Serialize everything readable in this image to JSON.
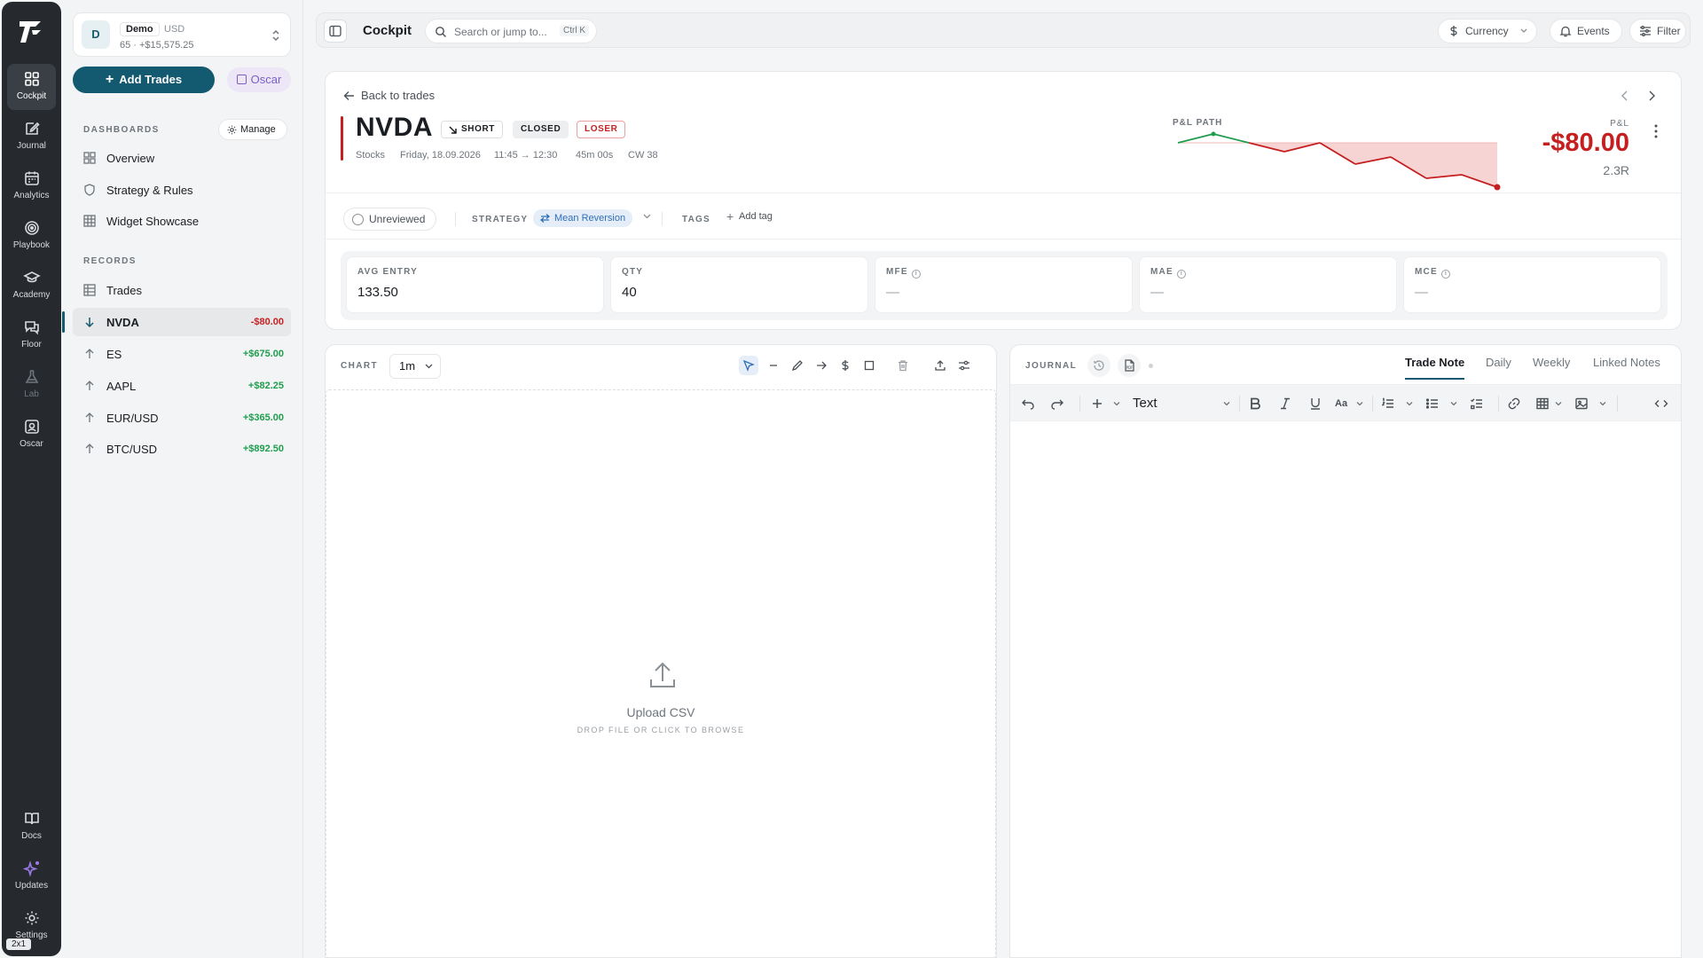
{
  "rail": {
    "items": [
      {
        "label": "Cockpit",
        "icon": "grid-icon"
      },
      {
        "label": "Journal",
        "icon": "journal-icon"
      },
      {
        "label": "Analytics",
        "icon": "calendar-icon"
      },
      {
        "label": "Playbook",
        "icon": "target-icon"
      },
      {
        "label": "Academy",
        "icon": "graduation-cap-icon"
      },
      {
        "label": "Floor",
        "icon": "chat-icon"
      },
      {
        "label": "Lab",
        "icon": "flask-icon"
      },
      {
        "label": "Oscar",
        "icon": "oscar-icon"
      }
    ],
    "bottom": [
      {
        "label": "Docs",
        "icon": "book-icon"
      },
      {
        "label": "Updates",
        "icon": "sparkle-icon"
      },
      {
        "label": "Settings",
        "icon": "gear-icon"
      }
    ],
    "badge": "2x1"
  },
  "account": {
    "initial": "D",
    "name": "Demo",
    "currency": "USD",
    "summary": "65 · +$15,575.25"
  },
  "actions": {
    "add_trades": "Add Trades",
    "oscar": "Oscar"
  },
  "dashboards": {
    "label": "DASHBOARDS",
    "manage": "Manage",
    "items": [
      "Overview",
      "Strategy & Rules",
      "Widget Showcase"
    ]
  },
  "records": {
    "label": "RECORDS",
    "trades_label": "Trades",
    "items": [
      {
        "symbol": "NVDA",
        "pnl": "-$80.00",
        "direction": "down"
      },
      {
        "symbol": "ES",
        "pnl": "+$675.00",
        "direction": "up"
      },
      {
        "symbol": "AAPL",
        "pnl": "+$82.25",
        "direction": "up"
      },
      {
        "symbol": "EUR/USD",
        "pnl": "+$365.00",
        "direction": "up"
      },
      {
        "symbol": "BTC/USD",
        "pnl": "+$892.50",
        "direction": "up"
      }
    ]
  },
  "topbar": {
    "title": "Cockpit",
    "search_placeholder": "Search or jump to...",
    "search_shortcut": "Ctrl K",
    "currency": "Currency",
    "events": "Events",
    "filter": "Filter"
  },
  "trade": {
    "back": "Back to trades",
    "symbol": "NVDA",
    "side": "SHORT",
    "status": "CLOSED",
    "result": "LOSER",
    "asset_class": "Stocks",
    "date": "Friday, 18.09.2026",
    "time": "11:45 → 12:30",
    "duration": "45m 00s",
    "week": "CW 38",
    "pl_path_label": "P&L PATH",
    "pl_label": "P&L",
    "pl_value": "-$80.00",
    "r_multiple": "2.3R",
    "pl_path": [
      0.0,
      0.05,
      0.0,
      -0.05,
      0.0,
      -0.12,
      -0.08,
      -0.2,
      -0.18,
      -0.25
    ],
    "review_status": "Unreviewed",
    "strategy_label": "STRATEGY",
    "strategy": "Mean Reversion",
    "tags_label": "TAGS",
    "add_tag": "Add tag",
    "stats": [
      {
        "label": "AVG ENTRY",
        "value": "133.50",
        "info": false
      },
      {
        "label": "QTY",
        "value": "40",
        "info": false
      },
      {
        "label": "MFE",
        "value": "—",
        "info": true
      },
      {
        "label": "MAE",
        "value": "—",
        "info": true
      },
      {
        "label": "MCE",
        "value": "—",
        "info": true
      }
    ]
  },
  "chart": {
    "label": "CHART",
    "timeframe": "1m",
    "upload_title": "Upload CSV",
    "upload_sub": "DROP FILE OR CLICK TO BROWSE"
  },
  "journal": {
    "label": "JOURNAL",
    "tabs": [
      "Trade Note",
      "Daily",
      "Weekly",
      "Linked Notes"
    ],
    "block_type": "Text"
  },
  "colors": {
    "accent": "#13596f",
    "loss": "#c51f1f",
    "gain": "#1f9d4f",
    "strategy": "#2f6fb8"
  }
}
